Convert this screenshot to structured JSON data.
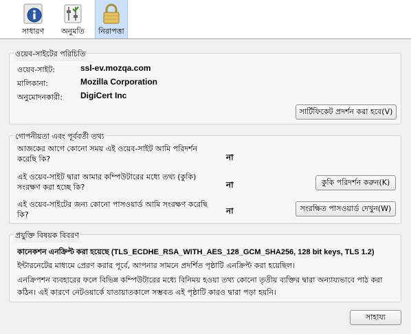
{
  "toolbar": {
    "tabs": [
      {
        "label": "সাধারণ",
        "icon": "info-icon"
      },
      {
        "label": "অনুমতি",
        "icon": "permissions-icon"
      },
      {
        "label": "নিরাপত্তা",
        "icon": "padlock-icon"
      }
    ]
  },
  "identity": {
    "title": "ওয়েব-সাইটের পরিচিতি",
    "website_label": "ওয়েব-সাইট:",
    "website_value": "ssl-ev.mozqa.com",
    "owner_label": "মালিকানা:",
    "owner_value": "Mozilla Corporation",
    "verifier_label": "অনুমোদনকারী:",
    "verifier_value": "DigiCert Inc",
    "view_cert_button": "সার্টিফিকেট প্রদর্শন করা হবে(V)"
  },
  "privacy": {
    "title": "গোপনীয়তা এবং পূর্ববর্তী তথ্য",
    "q1": "আজকের আগে কোনো সময় এই ওয়েব-সাইট আমি পরিদর্শন করেছি কি?",
    "a1": "না",
    "q2": "এই ওয়েব-সাইট দ্বারা আমার কম্পিউটারের মধ্যে তথ্য (কুকি) সংরক্ষণ করা হচ্ছে কি?",
    "a2": "না",
    "cookies_button": "কুকি পরিদর্শন করুন(K)",
    "q3": "এই ওয়েব-সাইটের জন্য কোনো পাসওয়ার্ড আমি সংরক্ষণ করেছি কি?",
    "a3": "না",
    "passwords_button": "সংরক্ষিত পাসওয়ার্ড দেখুন(W)"
  },
  "technical": {
    "title": "প্রযুক্তি বিষয়ক বিবরণ",
    "connection": "কানেকশন এনক্রিপ্ট করা হয়েছে (TLS_ECDHE_RSA_WITH_AES_128_GCM_SHA256, 128 bit keys, TLS 1.2)",
    "line1": "ইন্টারনেটের মাধ্যমে প্রেরণ করার পূর্বে, আপনার সামনে প্রদর্শিত পৃষ্ঠাটি এনক্রিপ্ট করা হয়েছিল।",
    "line2": "এনক্রিপশন ব্যবহারের ফলে বিভিন্ন কম্পিউটারের মধ্যে বিনিময় হওয়া তথ্য কোনো তৃতীয় ব্যক্তির দ্বারা অন্যায্যভাবে পাঠ করা",
    "line3": "কঠিন। এই কারণে নেটওয়ার্কে যাতায়াতকালে সম্ভবত এই পৃষ্ঠাটি কারও দ্বারা পড়া হয়নি।"
  },
  "help_button": "সাহায্য"
}
